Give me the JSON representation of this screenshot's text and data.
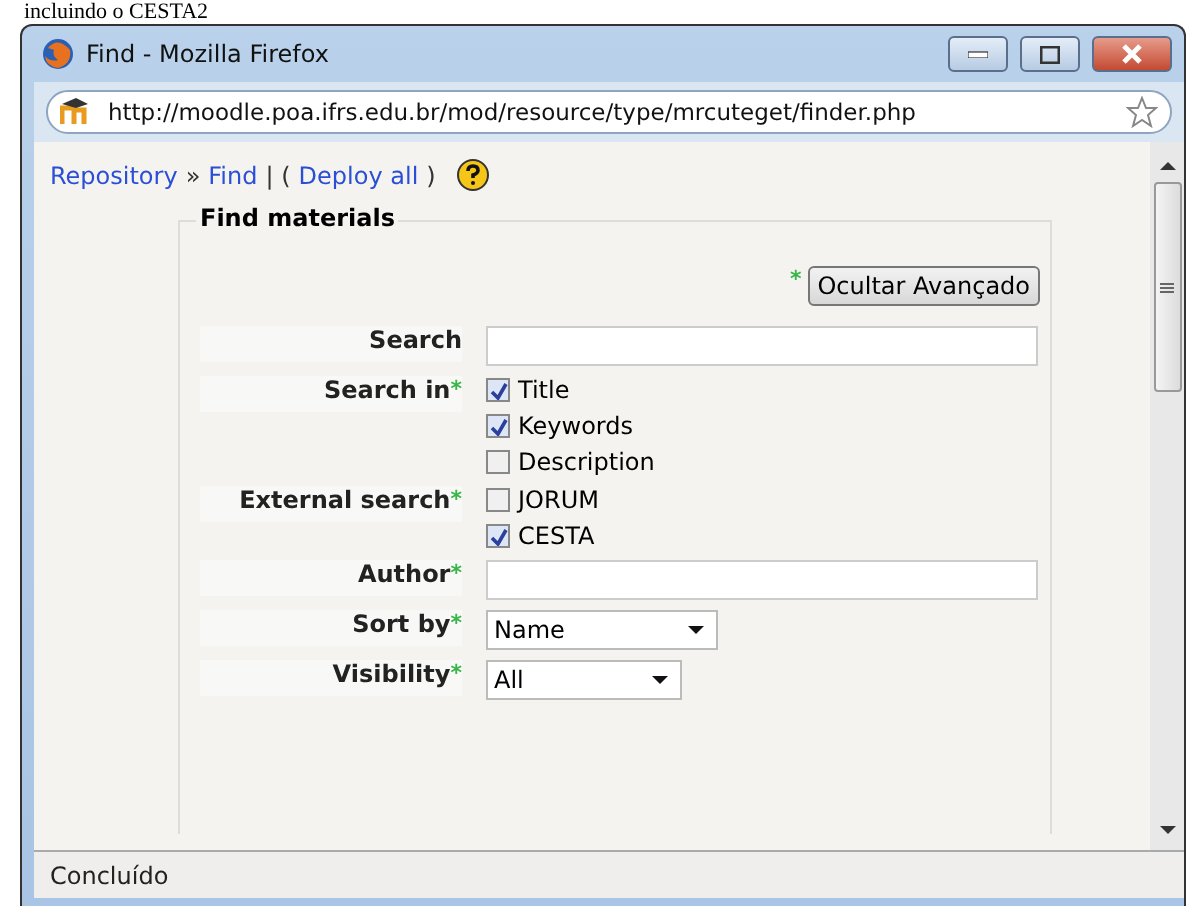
{
  "caption": "incluindo o CESTA2",
  "window": {
    "title": "Find - Mozilla Firefox"
  },
  "address_bar": {
    "url": "http://moodle.poa.ifrs.edu.br/mod/resource/type/mrcuteget/finder.php"
  },
  "breadcrumb": [
    {
      "text": "Repository",
      "kind": "link"
    },
    {
      "text": "»",
      "kind": "sep"
    },
    {
      "text": "Find",
      "kind": "link"
    },
    {
      "text": "| (",
      "kind": "sep"
    },
    {
      "text": "Deploy all",
      "kind": "link"
    },
    {
      "text": ")",
      "kind": "sep"
    }
  ],
  "form": {
    "legend": "Find materials",
    "advanced_button": {
      "label": "Ocultar Avançado",
      "mark": "*"
    },
    "fields": [
      {
        "label": "Search",
        "kind": "text"
      },
      {
        "label": "Search in",
        "mark": "*",
        "kind": "checkboxes",
        "options": [
          {
            "label": "Title",
            "checked": true
          },
          {
            "label": "Keywords",
            "checked": true
          },
          {
            "label": "Description",
            "checked": false
          }
        ]
      },
      {
        "label": "External search",
        "mark": "*",
        "kind": "checkboxes",
        "options": [
          {
            "label": "JORUM",
            "checked": false
          },
          {
            "label": "CESTA",
            "checked": true
          }
        ]
      },
      {
        "label": "Author",
        "mark": "*",
        "kind": "text"
      },
      {
        "label": "Sort by",
        "mark": "*",
        "kind": "select",
        "value": "Name",
        "wide": true
      },
      {
        "label": "Visibility",
        "mark": "*",
        "kind": "select",
        "value": "All",
        "wide": false
      }
    ]
  },
  "status_bar": {
    "text": "Concluído"
  }
}
